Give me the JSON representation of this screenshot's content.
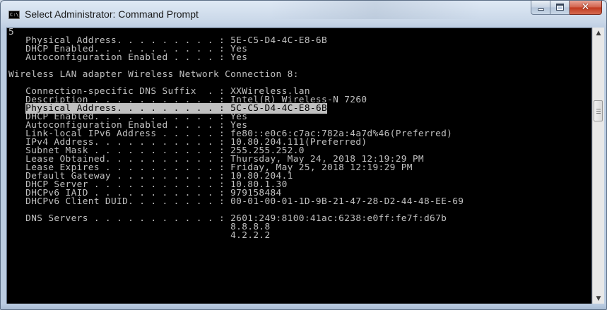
{
  "window": {
    "title": "Select Administrator: Command Prompt",
    "icon_text": "C:\\.",
    "icon": "cmd-icon",
    "buttons": {
      "minimize": "minimize-icon",
      "maximize": "maximize-icon",
      "close": "✕"
    }
  },
  "console": {
    "lines": [
      {
        "text": "5"
      },
      {
        "text": "   Physical Address. . . . . . . . . : 5E-C5-D4-4C-E8-6B"
      },
      {
        "text": "   DHCP Enabled. . . . . . . . . . . : Yes"
      },
      {
        "text": "   Autoconfiguration Enabled . . . . : Yes"
      },
      {
        "text": ""
      },
      {
        "text": "Wireless LAN adapter Wireless Network Connection 8:"
      },
      {
        "text": ""
      },
      {
        "text": "   Connection-specific DNS Suffix  . : XXWireless.lan"
      },
      {
        "text": "   Description . . . . . . . . . . . : Intel(R) Wireless-N 7260"
      },
      {
        "text": "   Physical Address. . . . . . . . . : 5C-C5-D4-4C-E8-6B",
        "highlighted": true
      },
      {
        "text": "   DHCP Enabled. . . . . . . . . . . : Yes"
      },
      {
        "text": "   Autoconfiguration Enabled . . . . : Yes"
      },
      {
        "text": "   Link-local IPv6 Address . . . . . : fe80::e0c6:c7ac:782a:4a7d%46(Preferred)"
      },
      {
        "text": "   IPv4 Address. . . . . . . . . . . : 10.80.204.111(Preferred)"
      },
      {
        "text": "   Subnet Mask . . . . . . . . . . . : 255.255.252.0"
      },
      {
        "text": "   Lease Obtained. . . . . . . . . . : Thursday, May 24, 2018 12:19:29 PM"
      },
      {
        "text": "   Lease Expires . . . . . . . . . . : Friday, May 25, 2018 12:19:29 PM"
      },
      {
        "text": "   Default Gateway . . . . . . . . . : 10.80.204.1"
      },
      {
        "text": "   DHCP Server . . . . . . . . . . . : 10.80.1.30"
      },
      {
        "text": "   DHCPv6 IAID . . . . . . . . . . . : 979158484"
      },
      {
        "text": "   DHCPv6 Client DUID. . . . . . . . : 00-01-00-01-1D-9B-21-47-28-D2-44-48-EE-69"
      },
      {
        "text": ""
      },
      {
        "text": "   DNS Servers . . . . . . . . . . . : 2601:249:8100:41ac:6238:e0ff:fe7f:d67b"
      },
      {
        "text": "                                       8.8.8.8"
      },
      {
        "text": "                                       4.2.2.2"
      }
    ]
  },
  "scrollbar": {
    "up_icon": "▲",
    "down_icon": "▼"
  },
  "colors": {
    "console_bg": "#000000",
    "console_fg": "#c0c0c0",
    "highlight_bg": "#c0c0c0",
    "highlight_fg": "#000000",
    "close_button": "#c0391f"
  }
}
